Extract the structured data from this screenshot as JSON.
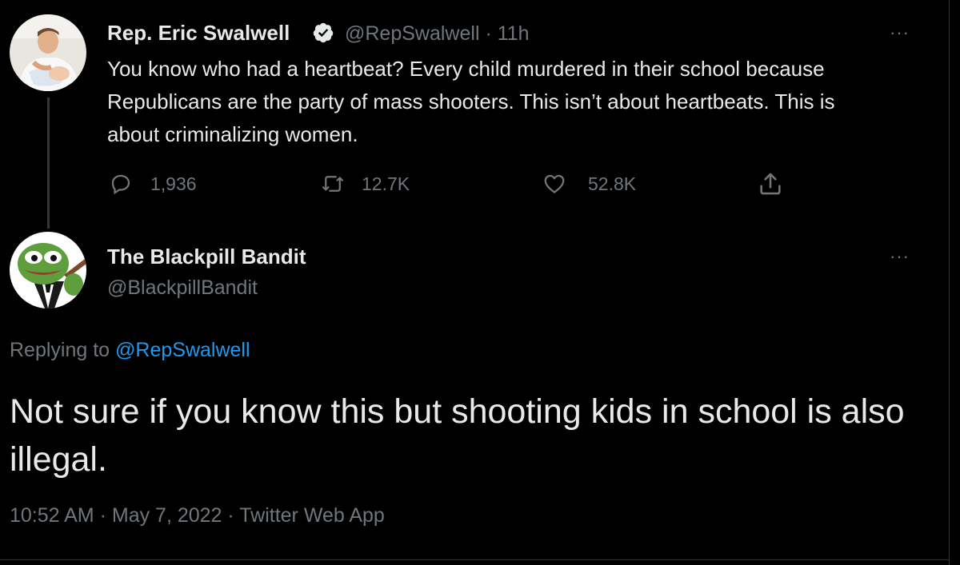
{
  "tweet": {
    "author_name": "Rep. Eric Swalwell",
    "handle": "@RepSwalwell",
    "separator": "·",
    "time_ago": "11h",
    "verified_icon": "verified-badge-icon",
    "avatar": "profile-photo-avatar",
    "text": "You know who had a heartbeat? Every child murdered in their school because Republicans are the party of mass shooters. This isn’t about heartbeats. This is about criminalizing women.",
    "actions": {
      "reply": {
        "icon": "reply-icon",
        "count": "1,936"
      },
      "retweet": {
        "icon": "retweet-icon",
        "count": "12.7K"
      },
      "like": {
        "icon": "heart-icon",
        "count": "52.8K"
      },
      "share": {
        "icon": "share-icon"
      }
    },
    "more_icon": "more-options-icon",
    "more_label": "···"
  },
  "reply": {
    "author_name": "The Blackpill Bandit",
    "handle": "@BlackpillBandit",
    "avatar": "frog-cartoon-avatar",
    "more_label": "···",
    "replying_prefix": "Replying to",
    "replying_mention": "@RepSwalwell",
    "text": "Not sure if you know this but shooting kids in school is also illegal.",
    "timestamp": "10:52 AM",
    "date": "May 7, 2022",
    "source": "Twitter Web App",
    "separator": "·"
  },
  "colors": {
    "background": "#000000",
    "text_primary": "#e7e9ea",
    "text_secondary": "#71767b",
    "accent": "#1d9bf0",
    "border": "#2f3336"
  }
}
